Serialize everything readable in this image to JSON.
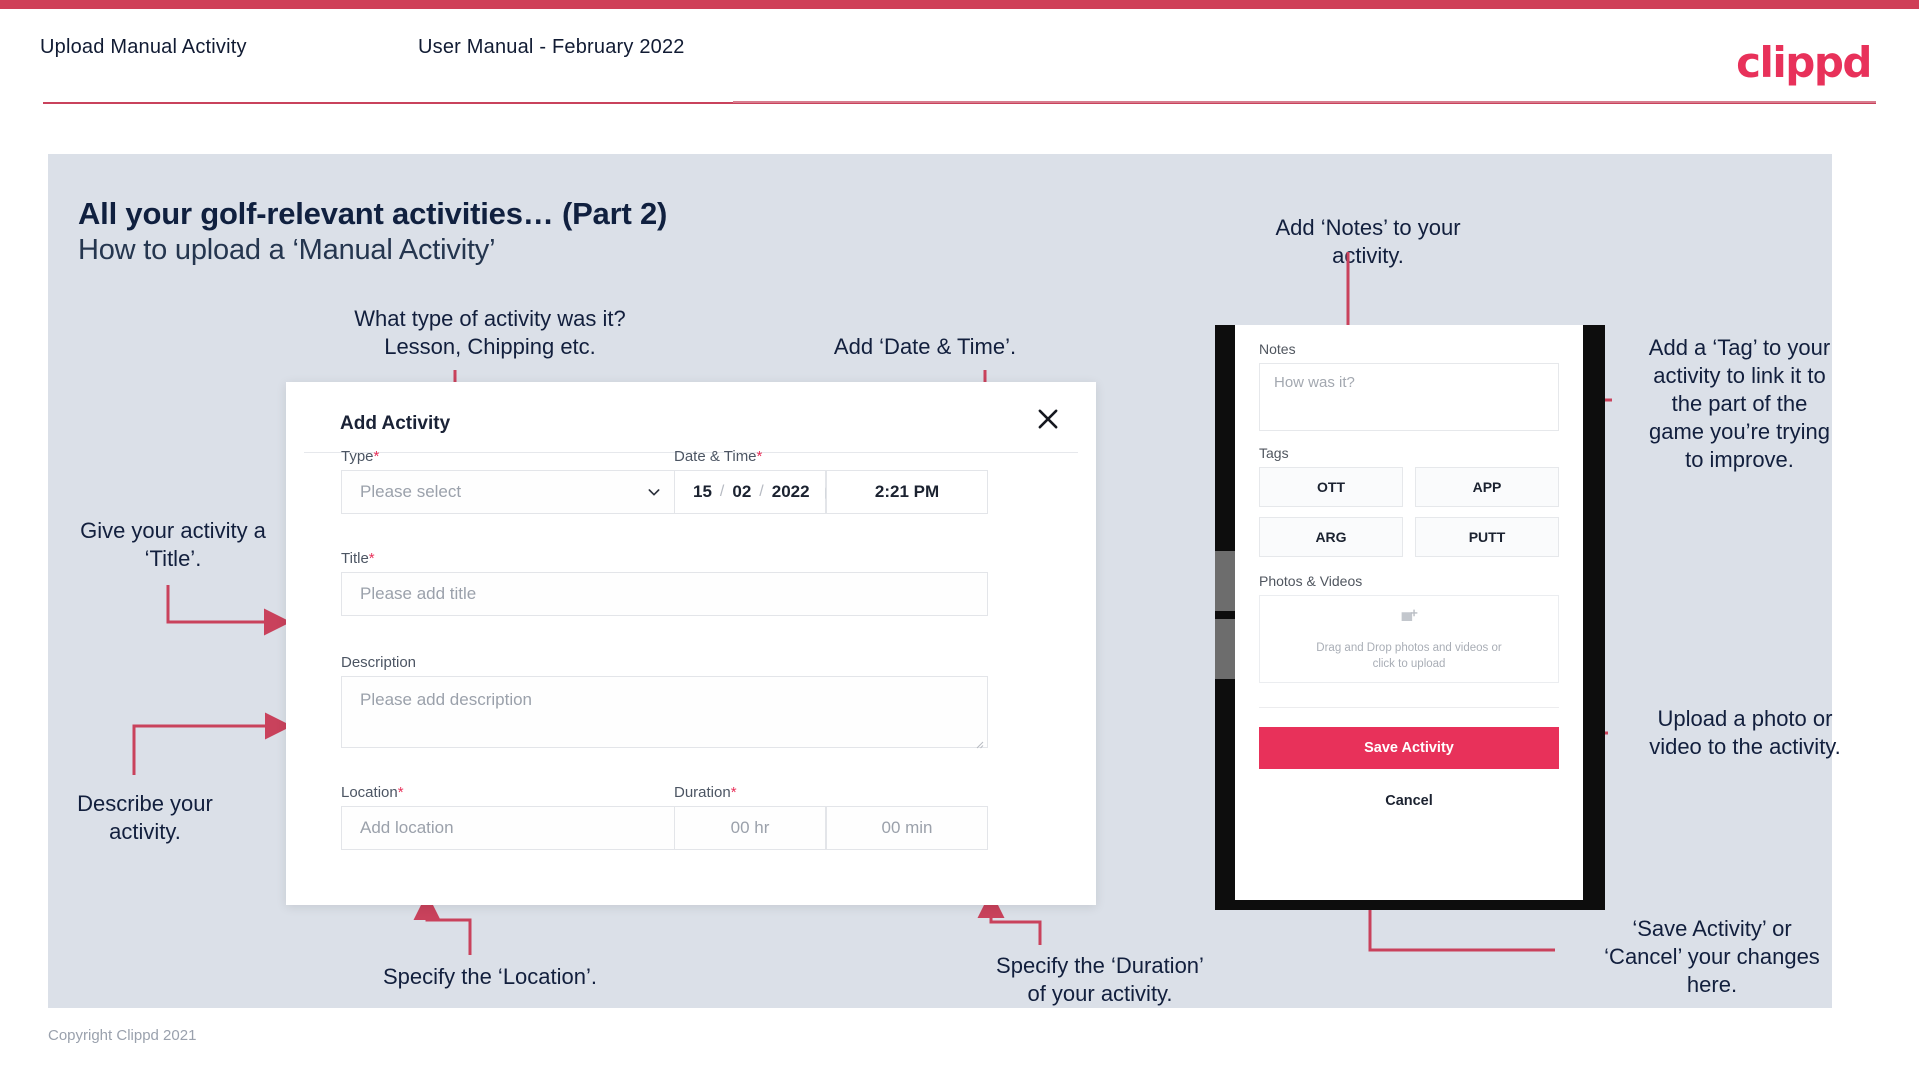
{
  "header": {
    "left_title": "Upload Manual Activity",
    "center_title": "User Manual - February 2022",
    "brand": "clippd",
    "accent_color": "#cf4058"
  },
  "slide": {
    "title_line1": "All your golf-relevant activities… (Part 2)",
    "title_line2": "How to upload a ‘Manual Activity’",
    "copyright": "Copyright Clippd 2021",
    "background": "#dbe0e8"
  },
  "annotations": {
    "type": "What type of activity was it?\nLesson, Chipping etc.",
    "type_l1": "What type of activity was it?",
    "type_l2": "Lesson, Chipping etc.",
    "datetime": "Add ‘Date & Time’.",
    "title_l1": "Give your activity a",
    "title_l2": "‘Title’.",
    "describe_l1": "Describe your",
    "describe_l2": "activity.",
    "location": "Specify the ‘Location’.",
    "duration_l1": "Specify the ‘Duration’",
    "duration_l2": "of your activity.",
    "notes_l1": "Add ‘Notes’ to your",
    "notes_l2": "activity.",
    "tag_l1": "Add a ‘Tag’ to your",
    "tag_l2": "activity to link it to",
    "tag_l3": "the part of the",
    "tag_l4": "game you’re trying",
    "tag_l5": "to improve.",
    "upload_l1": "Upload a photo or",
    "upload_l2": "video to the activity.",
    "save_l1": "‘Save Activity’ or",
    "save_l2": "‘Cancel’ your changes",
    "save_l3": "here.",
    "arrow_color": "#c9425c"
  },
  "modal": {
    "title": "Add Activity",
    "close_icon": "close-icon",
    "fields": {
      "type_label": "Type",
      "type_required": "*",
      "type_placeholder": "Please select",
      "datetime_label": "Date & Time",
      "datetime_required": "*",
      "date_day": "15",
      "date_month": "02",
      "date_year": "2022",
      "date_sep": "/",
      "time_value": "2:21 PM",
      "title_label": "Title",
      "title_required": "*",
      "title_placeholder": "Please add title",
      "description_label": "Description",
      "description_placeholder": "Please add description",
      "location_label": "Location",
      "location_required": "*",
      "location_placeholder": "Add location",
      "duration_label": "Duration",
      "duration_required": "*",
      "duration_hr_placeholder": "00 hr",
      "duration_min_placeholder": "00 min"
    }
  },
  "phone": {
    "notes_label": "Notes",
    "notes_placeholder": "How was it?",
    "tags_label": "Tags",
    "tags": [
      "OTT",
      "APP",
      "ARG",
      "PUTT"
    ],
    "photos_label": "Photos & Videos",
    "dropzone_l1": "Drag and Drop photos and videos or",
    "dropzone_l2": "click to upload",
    "save_label": "Save Activity",
    "cancel_label": "Cancel",
    "save_color": "#e8315a"
  }
}
